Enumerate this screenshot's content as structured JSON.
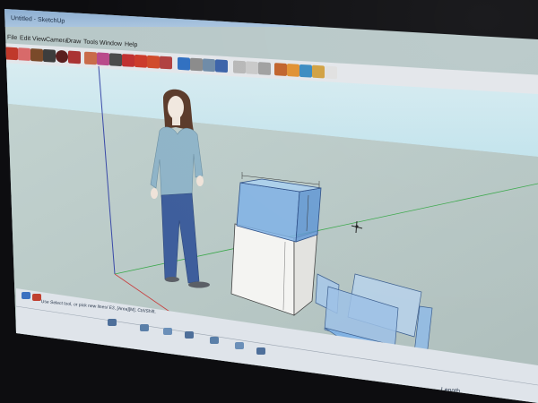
{
  "window": {
    "title": "Untitled - SketchUp"
  },
  "menu": [
    {
      "label": "File"
    },
    {
      "label": "Edit"
    },
    {
      "label": "View"
    },
    {
      "label": "Camera"
    },
    {
      "label": "Draw"
    },
    {
      "label": "Tools"
    },
    {
      "label": "Window"
    },
    {
      "label": "Help"
    }
  ],
  "toolbar_icons": [
    "select-icon",
    "eraser-icon",
    "pencil-icon",
    "rectangle-icon",
    "circle-icon",
    "arc-icon",
    "make-component-icon",
    "paint-bucket-icon",
    "push-pull-icon",
    "move-icon",
    "rotate-icon",
    "follow-me-icon",
    "offset-icon",
    "orbit-icon",
    "pan-icon",
    "zoom-icon",
    "zoom-extents-icon",
    "iso-view-icon",
    "top-view-icon",
    "front-view-icon",
    "section-plane-icon",
    "warehouse-icon",
    "shared-component-icon",
    "extension-icon",
    "google-earth-icon"
  ],
  "status": {
    "hint": "Use Select tool, or pick new lines/ E3, [Area][M], Ctrl/Shift.",
    "measurement_label": "Length"
  },
  "colors": {
    "sky": "#cfe7ee",
    "ground": "#b9c9c7",
    "glass": "#7fb2e6",
    "figure_shirt": "#8fb4c8",
    "figure_pants": "#3e5e9c"
  }
}
